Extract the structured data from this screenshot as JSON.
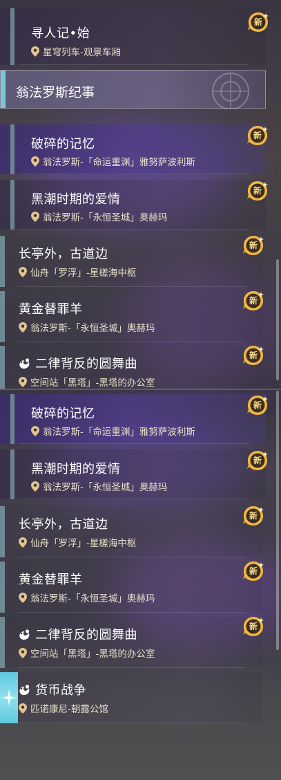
{
  "colors": {
    "accent_bar": "#6e8894",
    "header_bar": "#79c7d6",
    "badge_gold": "#f2b640",
    "location_text": "#e8dfc9"
  },
  "badge_label": "新",
  "panel_a": {
    "top_entry": {
      "title": "寻人记•始",
      "location": "星穹列车-观景车厢"
    },
    "group_header": "翁法罗斯纪事",
    "entries": [
      {
        "title": "破碎的记忆",
        "location": "翁法罗斯-「命运重渊」雅努萨波利斯"
      },
      {
        "title": "黑潮时期的爱情",
        "location": "翁法罗斯-「永恒圣城」奥赫玛"
      },
      {
        "title": "长亭外，古道边",
        "location": "仙舟「罗浮」-星槎海中枢"
      },
      {
        "title": "黄金替罪羊",
        "location": "翁法罗斯-「永恒圣城」奥赫玛"
      },
      {
        "title": "二律背反的圆舞曲",
        "location": "空间站「黑塔」-黑塔的办公室"
      }
    ]
  },
  "panel_b": {
    "entries": [
      {
        "title": "破碎的记忆",
        "location": "翁法罗斯-「命运重渊」雅努萨波利斯"
      },
      {
        "title": "黑潮时期的爱情",
        "location": "翁法罗斯-「永恒圣城」奥赫玛"
      },
      {
        "title": "长亭外，古道边",
        "location": "仙舟「罗浮」-星槎海中枢"
      },
      {
        "title": "黄金替罪羊",
        "location": "翁法罗斯-「永恒圣城」奥赫玛"
      },
      {
        "title": "二律背反的圆舞曲",
        "location": "空间站「黑塔」-黑塔的办公室"
      },
      {
        "title": "货币战争",
        "location": "匹诺康尼-朝露公馆"
      }
    ]
  }
}
